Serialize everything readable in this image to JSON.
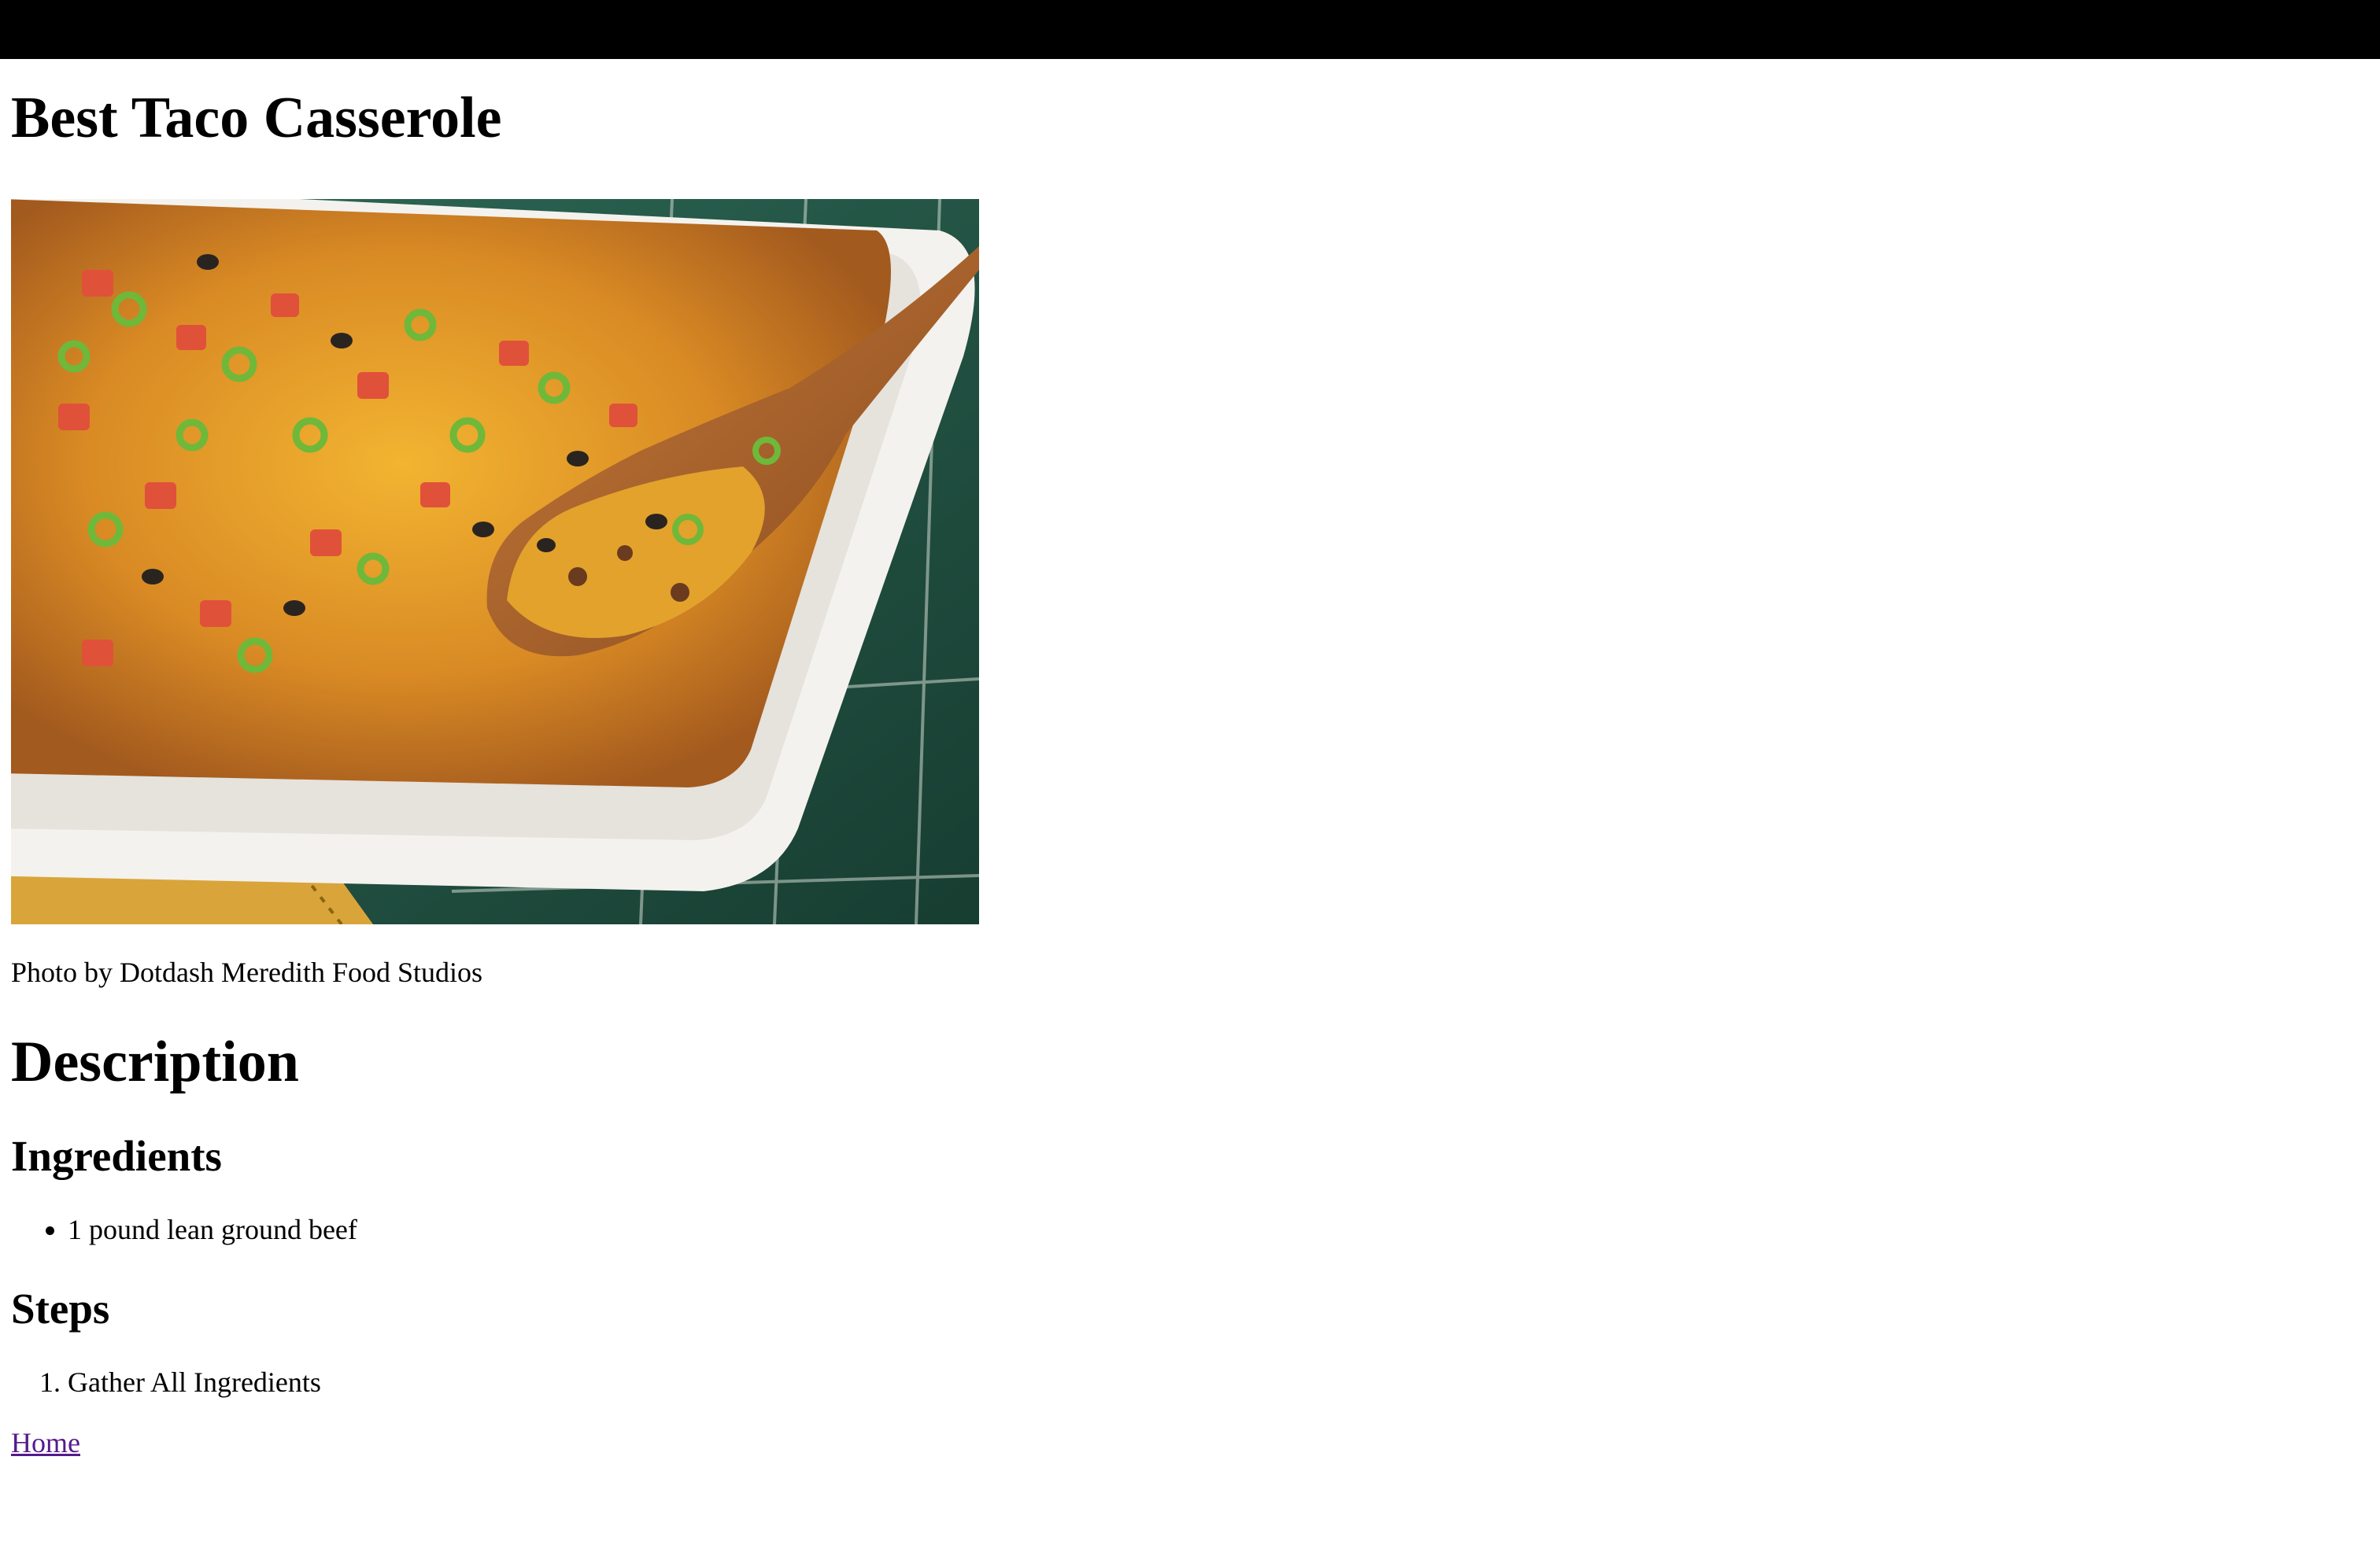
{
  "page": {
    "title": "Best Taco Casserole",
    "photo_alt": "Best Taco Casserole",
    "photo_caption": "Photo by Dotdash Meredith Food Studios"
  },
  "sections": {
    "description_heading": "Description",
    "ingredients_heading": "Ingredients",
    "ingredients": [
      "1 pound lean ground beef"
    ],
    "steps_heading": "Steps",
    "steps": [
      "Gather All Ingredients"
    ]
  },
  "nav": {
    "home_label": "Home"
  },
  "colors": {
    "top_bar": "#000000",
    "visited_link": "#551a8b"
  }
}
